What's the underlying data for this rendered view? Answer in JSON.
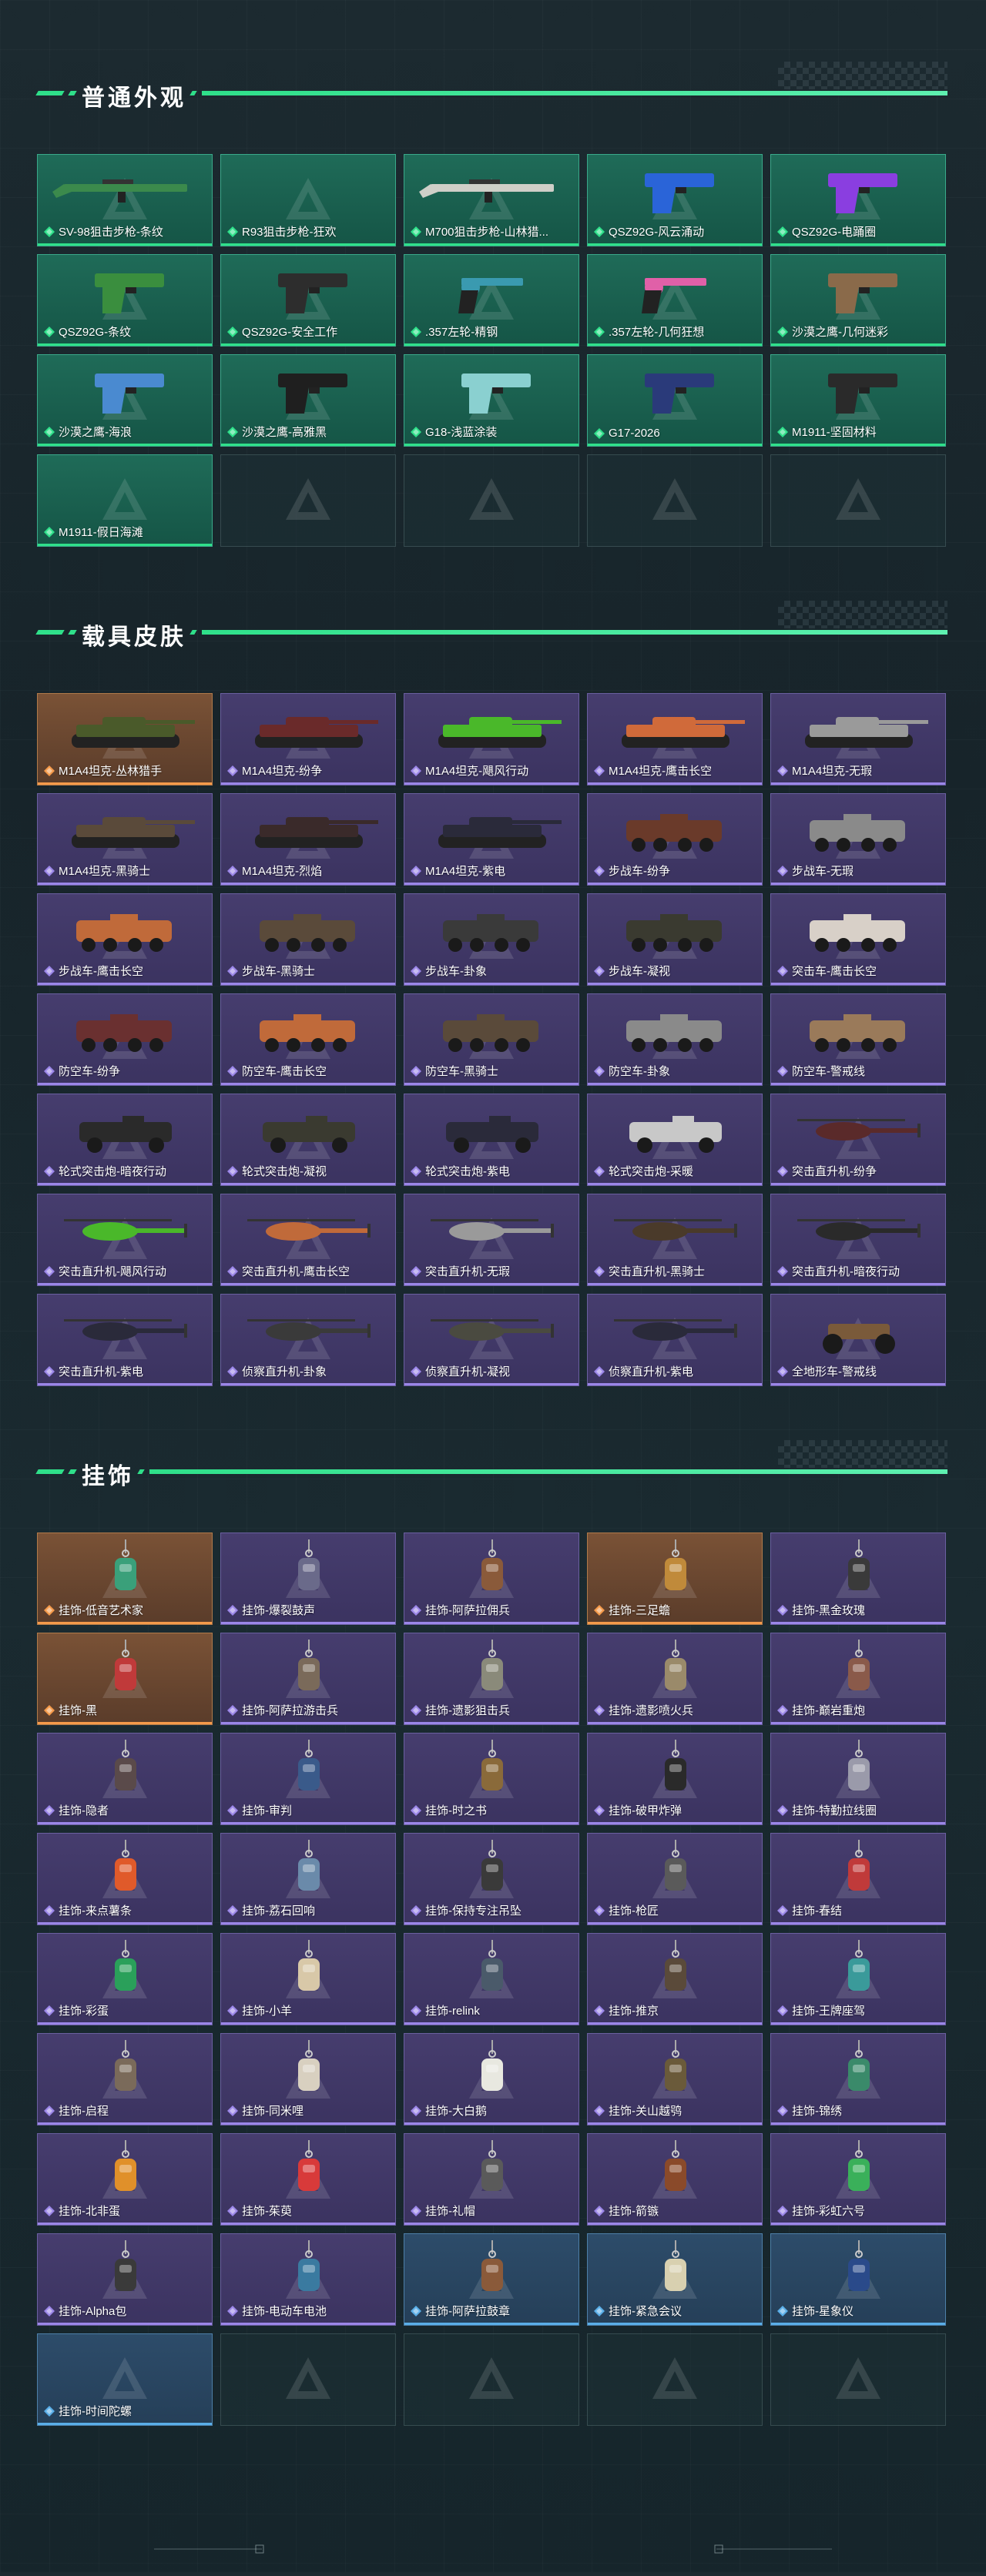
{
  "sections": [
    {
      "title": "普通外观",
      "items": [
        {
          "label": "SV-98狙击步枪-条纹",
          "rarity": "green",
          "art": "rifle",
          "color": "#3b8a4c"
        },
        {
          "label": "R93狙击步枪-狂欢",
          "rarity": "green",
          "art": "none",
          "color": ""
        },
        {
          "label": "M700狙击步枪-山林猎...",
          "rarity": "green",
          "art": "rifle",
          "color": "#cfcfc8"
        },
        {
          "label": "QSZ92G-风云涌动",
          "rarity": "green",
          "art": "pistol",
          "color": "#2a64d8"
        },
        {
          "label": "QSZ92G-电踊圈",
          "rarity": "green",
          "art": "pistol",
          "color": "#8a3ee0"
        },
        {
          "label": "QSZ92G-条纹",
          "rarity": "green",
          "art": "pistol",
          "color": "#3a8e3e"
        },
        {
          "label": "QSZ92G-安全工作",
          "rarity": "green",
          "art": "pistol",
          "color": "#2d2d2d"
        },
        {
          "label": ".357左轮-精钢",
          "rarity": "green",
          "art": "revolver",
          "color": "#3a9ab0"
        },
        {
          "label": ".357左轮-几何狂想",
          "rarity": "green",
          "art": "revolver",
          "color": "#e060a8"
        },
        {
          "label": "沙漠之鹰-几何迷彩",
          "rarity": "green",
          "art": "pistol",
          "color": "#8a6a4a"
        },
        {
          "label": "沙漠之鹰-海浪",
          "rarity": "green",
          "art": "pistol",
          "color": "#4a8ad0"
        },
        {
          "label": "沙漠之鹰-高雅黑",
          "rarity": "green",
          "art": "pistol",
          "color": "#1f1f1f"
        },
        {
          "label": "G18-浅蓝涂装",
          "rarity": "green",
          "art": "pistol",
          "color": "#8ad0d0"
        },
        {
          "label": "G17-2026",
          "rarity": "green",
          "art": "pistol",
          "color": "#2a3a7a"
        },
        {
          "label": "M1911-坚固材料",
          "rarity": "green",
          "art": "pistol",
          "color": "#2a2a2a"
        },
        {
          "label": "M1911-假日海滩",
          "rarity": "green",
          "art": "none",
          "color": ""
        },
        {
          "label": "",
          "rarity": "empty",
          "art": "none",
          "color": ""
        },
        {
          "label": "",
          "rarity": "empty",
          "art": "none",
          "color": ""
        },
        {
          "label": "",
          "rarity": "empty",
          "art": "none",
          "color": ""
        },
        {
          "label": "",
          "rarity": "empty",
          "art": "none",
          "color": ""
        }
      ]
    },
    {
      "title": "载具皮肤",
      "items": [
        {
          "label": "M1A4坦克-丛林猎手",
          "rarity": "orange",
          "art": "tank",
          "color": "#4a5a2a"
        },
        {
          "label": "M1A4坦克-纷争",
          "rarity": "purple",
          "art": "tank",
          "color": "#6a2a2a"
        },
        {
          "label": "M1A4坦克-飓风行动",
          "rarity": "purple",
          "art": "tank",
          "color": "#4ab82a"
        },
        {
          "label": "M1A4坦克-鹰击长空",
          "rarity": "purple",
          "art": "tank",
          "color": "#d06a3a"
        },
        {
          "label": "M1A4坦克-无瑕",
          "rarity": "purple",
          "art": "tank",
          "color": "#9a9a9a"
        },
        {
          "label": "M1A4坦克-黑骑士",
          "rarity": "purple",
          "art": "tank",
          "color": "#5a4a3a"
        },
        {
          "label": "M1A4坦克-烈焰",
          "rarity": "purple",
          "art": "tank",
          "color": "#3a2a2a"
        },
        {
          "label": "M1A4坦克-紫电",
          "rarity": "purple",
          "art": "tank",
          "color": "#2a2a3a"
        },
        {
          "label": "步战车-纷争",
          "rarity": "purple",
          "art": "ifv",
          "color": "#6a3a2a"
        },
        {
          "label": "步战车-无瑕",
          "rarity": "purple",
          "art": "ifv",
          "color": "#8a8a8a"
        },
        {
          "label": "步战车-鹰击长空",
          "rarity": "purple",
          "art": "ifv",
          "color": "#c06a3a"
        },
        {
          "label": "步战车-黑骑士",
          "rarity": "purple",
          "art": "ifv",
          "color": "#5a4a3a"
        },
        {
          "label": "步战车-卦象",
          "rarity": "purple",
          "art": "ifv",
          "color": "#3a3a3a"
        },
        {
          "label": "步战车-凝视",
          "rarity": "purple",
          "art": "ifv",
          "color": "#3a3a30"
        },
        {
          "label": "突击车-鹰击长空",
          "rarity": "purple",
          "art": "ifv",
          "color": "#d8d0c8"
        },
        {
          "label": "防空车-纷争",
          "rarity": "purple",
          "art": "ifv",
          "color": "#6a3030"
        },
        {
          "label": "防空车-鹰击长空",
          "rarity": "purple",
          "art": "ifv",
          "color": "#c06a3a"
        },
        {
          "label": "防空车-黑骑士",
          "rarity": "purple",
          "art": "ifv",
          "color": "#5a4a3a"
        },
        {
          "label": "防空车-卦象",
          "rarity": "purple",
          "art": "ifv",
          "color": "#8a8a8a"
        },
        {
          "label": "防空车-警戒线",
          "rarity": "purple",
          "art": "ifv",
          "color": "#9a7a5a"
        },
        {
          "label": "轮式突击炮-暗夜行动",
          "rarity": "purple",
          "art": "apc",
          "color": "#2a2a2a"
        },
        {
          "label": "轮式突击炮-凝视",
          "rarity": "purple",
          "art": "apc",
          "color": "#3a3a30"
        },
        {
          "label": "轮式突击炮-紫电",
          "rarity": "purple",
          "art": "apc",
          "color": "#2a2a3a"
        },
        {
          "label": "轮式突击炮-采暖",
          "rarity": "purple",
          "art": "apc",
          "color": "#c8c8c8"
        },
        {
          "label": "突击直升机-纷争",
          "rarity": "purple",
          "art": "heli",
          "color": "#5a2a2a"
        },
        {
          "label": "突击直升机-飓风行动",
          "rarity": "purple",
          "art": "heli",
          "color": "#4ab82a"
        },
        {
          "label": "突击直升机-鹰击长空",
          "rarity": "purple",
          "art": "heli",
          "color": "#c06a3a"
        },
        {
          "label": "突击直升机-无瑕",
          "rarity": "purple",
          "art": "heli",
          "color": "#9a9a9a"
        },
        {
          "label": "突击直升机-黑骑士",
          "rarity": "purple",
          "art": "heli",
          "color": "#4a3a2a"
        },
        {
          "label": "突击直升机-暗夜行动",
          "rarity": "purple",
          "art": "heli",
          "color": "#2a2a2a"
        },
        {
          "label": "突击直升机-紫电",
          "rarity": "purple",
          "art": "heli",
          "color": "#2a2a3a"
        },
        {
          "label": "侦察直升机-卦象",
          "rarity": "purple",
          "art": "heli",
          "color": "#3a3a3a"
        },
        {
          "label": "侦察直升机-凝视",
          "rarity": "purple",
          "art": "heli",
          "color": "#4a4a40"
        },
        {
          "label": "侦察直升机-紫电",
          "rarity": "purple",
          "art": "heli",
          "color": "#2a2a3a"
        },
        {
          "label": "全地形车-警戒线",
          "rarity": "purple",
          "art": "atv",
          "color": "#7a5a3a"
        }
      ]
    },
    {
      "title": "挂饰",
      "items": [
        {
          "label": "挂饰-低音艺术家",
          "rarity": "orange",
          "art": "charm",
          "color": "#3aa07a"
        },
        {
          "label": "挂饰-爆裂鼓声",
          "rarity": "purple",
          "art": "charm",
          "color": "#6a6a8a"
        },
        {
          "label": "挂饰-阿萨拉佣兵",
          "rarity": "purple",
          "art": "charm",
          "color": "#8a5a3a"
        },
        {
          "label": "挂饰-三足蟾",
          "rarity": "orange",
          "art": "charm",
          "color": "#c08a3a"
        },
        {
          "label": "挂饰-黑金玫瑰",
          "rarity": "purple",
          "art": "charm",
          "color": "#3a3a3a"
        },
        {
          "label": "挂饰-黑",
          "rarity": "orange",
          "art": "charm",
          "color": "#c03a3a"
        },
        {
          "label": "挂饰-阿萨拉游击兵",
          "rarity": "purple",
          "art": "charm",
          "color": "#7a6a5a"
        },
        {
          "label": "挂饰-遗影狙击兵",
          "rarity": "purple",
          "art": "charm",
          "color": "#8a8a7a"
        },
        {
          "label": "挂饰-遗影喷火兵",
          "rarity": "purple",
          "art": "charm",
          "color": "#9a8a6a"
        },
        {
          "label": "挂饰-巅岩重炮",
          "rarity": "purple",
          "art": "charm",
          "color": "#8a5a4a"
        },
        {
          "label": "挂饰-隐者",
          "rarity": "purple",
          "art": "charm",
          "color": "#5a4a4a"
        },
        {
          "label": "挂饰-审判",
          "rarity": "purple",
          "art": "charm",
          "color": "#3a5a8a"
        },
        {
          "label": "挂饰-时之书",
          "rarity": "purple",
          "art": "charm",
          "color": "#8a6a3a"
        },
        {
          "label": "挂饰-破甲炸弹",
          "rarity": "purple",
          "art": "charm",
          "color": "#2a2a2a"
        },
        {
          "label": "挂饰-特勤拉线圈",
          "rarity": "purple",
          "art": "charm",
          "color": "#9a9aaa"
        },
        {
          "label": "挂饰-来点薯条",
          "rarity": "purple",
          "art": "charm",
          "color": "#e05a2a"
        },
        {
          "label": "挂饰-荔石回响",
          "rarity": "purple",
          "art": "charm",
          "color": "#6a8aaa"
        },
        {
          "label": "挂饰-保持专注吊坠",
          "rarity": "purple",
          "art": "charm",
          "color": "#3a3a3a"
        },
        {
          "label": "挂饰-枪匠",
          "rarity": "purple",
          "art": "charm",
          "color": "#5a5a5a"
        },
        {
          "label": "挂饰-春结",
          "rarity": "purple",
          "art": "charm",
          "color": "#c03a3a"
        },
        {
          "label": "挂饰-彩蛋",
          "rarity": "purple",
          "art": "charm",
          "color": "#2aa05a"
        },
        {
          "label": "挂饰-小羊",
          "rarity": "purple",
          "art": "charm",
          "color": "#d8c8a8"
        },
        {
          "label": "挂饰-relink",
          "rarity": "purple",
          "art": "charm",
          "color": "#4a5a6a"
        },
        {
          "label": "挂饰-推京",
          "rarity": "purple",
          "art": "charm",
          "color": "#5a4a3a"
        },
        {
          "label": "挂饰-王牌座驾",
          "rarity": "purple",
          "art": "charm",
          "color": "#3a9a9a"
        },
        {
          "label": "挂饰-启程",
          "rarity": "purple",
          "art": "charm",
          "color": "#7a6a5a"
        },
        {
          "label": "挂饰-同米哩",
          "rarity": "purple",
          "art": "charm",
          "color": "#d8d0c0"
        },
        {
          "label": "挂饰-大白鹅",
          "rarity": "purple",
          "art": "charm",
          "color": "#e8e8e0"
        },
        {
          "label": "挂饰-关山越鸮",
          "rarity": "purple",
          "art": "charm",
          "color": "#6a5a3a"
        },
        {
          "label": "挂饰-锦绣",
          "rarity": "purple",
          "art": "charm",
          "color": "#3a8a6a"
        },
        {
          "label": "挂饰-北非蛋",
          "rarity": "purple",
          "art": "charm",
          "color": "#e0902a"
        },
        {
          "label": "挂饰-茱萸",
          "rarity": "purple",
          "art": "charm",
          "color": "#d83a3a"
        },
        {
          "label": "挂饰-礼帽",
          "rarity": "purple",
          "art": "charm",
          "color": "#5a5a5a"
        },
        {
          "label": "挂饰-箭镞",
          "rarity": "purple",
          "art": "charm",
          "color": "#8a4a2a"
        },
        {
          "label": "挂饰-彩虹六号",
          "rarity": "purple",
          "art": "charm",
          "color": "#3ab05a"
        },
        {
          "label": "挂饰-Alpha包",
          "rarity": "purple",
          "art": "charm",
          "color": "#3a3a3a"
        },
        {
          "label": "挂饰-电动车电池",
          "rarity": "purple",
          "art": "charm",
          "color": "#3a7aa0"
        },
        {
          "label": "挂饰-阿萨拉鼓章",
          "rarity": "blue",
          "art": "charm",
          "color": "#8a5a3a"
        },
        {
          "label": "挂饰-紧急会议",
          "rarity": "blue",
          "art": "charm",
          "color": "#d8d0b0"
        },
        {
          "label": "挂饰-星象仪",
          "rarity": "blue",
          "art": "charm",
          "color": "#2a4a8a"
        },
        {
          "label": "挂饰-时间陀螺",
          "rarity": "blue",
          "art": "none",
          "color": ""
        },
        {
          "label": "",
          "rarity": "empty",
          "art": "none",
          "color": ""
        },
        {
          "label": "",
          "rarity": "empty",
          "art": "none",
          "color": ""
        },
        {
          "label": "",
          "rarity": "empty",
          "art": "none",
          "color": ""
        },
        {
          "label": "",
          "rarity": "empty",
          "art": "none",
          "color": ""
        }
      ]
    }
  ],
  "accent_color": "#2fe08a",
  "rarity_colors": {
    "green": "#2fe08a",
    "purple": "#9b86e8",
    "orange": "#f59a4a",
    "blue": "#5aaee8"
  }
}
